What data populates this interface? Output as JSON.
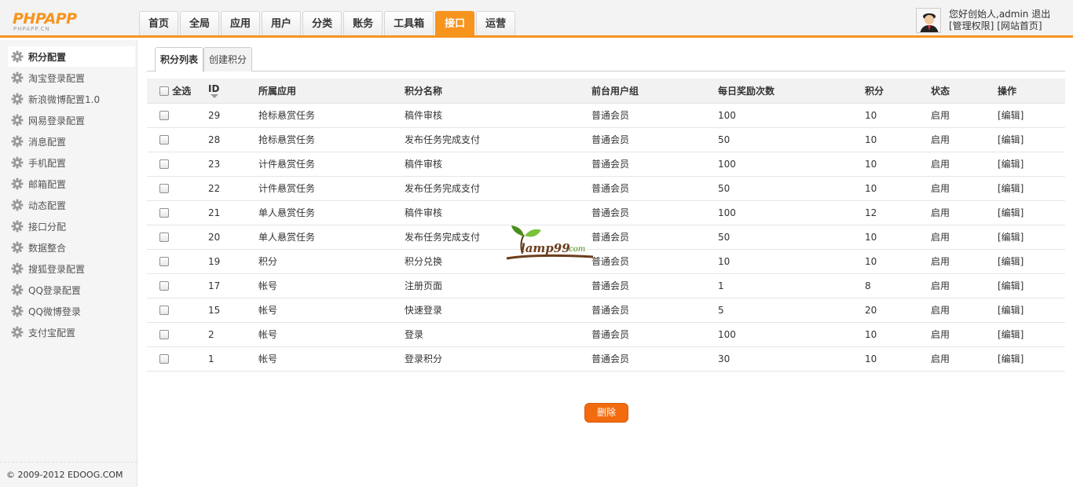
{
  "header": {
    "logo_text": "PHPAPP",
    "logo_sub": "PHPAPP.CN",
    "nav": [
      "首页",
      "全局",
      "应用",
      "用户",
      "分类",
      "账务",
      "工具箱",
      "接口",
      "运营"
    ],
    "nav_active_index": 7,
    "user": {
      "greeting": "您好创始人,admin",
      "logout": "退出",
      "admin_rights": "[管理权限]",
      "site_home": "[网站首页]"
    }
  },
  "sidebar": {
    "items": [
      "积分配置",
      "淘宝登录配置",
      "新浪微博配置1.0",
      "网易登录配置",
      "消息配置",
      "手机配置",
      "邮箱配置",
      "动态配置",
      "接口分配",
      "数据整合",
      "搜狐登录配置",
      "QQ登录配置",
      "QQ微博登录",
      "支付宝配置"
    ],
    "active_index": 0,
    "copyright": "© 2009-2012 EDOOG.COM"
  },
  "subtabs": [
    "积分列表",
    "创建积分"
  ],
  "table": {
    "headers": {
      "select_all": "全选",
      "id": "ID",
      "app": "所属应用",
      "name": "积分名称",
      "group": "前台用户组",
      "daily": "每日奖励次数",
      "points": "积分",
      "status": "状态",
      "action": "操作"
    },
    "rows": [
      {
        "id": "29",
        "app": "抢标悬赏任务",
        "name": "稿件审核",
        "group": "普通会员",
        "daily": "100",
        "points": "10",
        "status": "启用",
        "action": "[编辑]"
      },
      {
        "id": "28",
        "app": "抢标悬赏任务",
        "name": "发布任务完成支付",
        "group": "普通会员",
        "daily": "50",
        "points": "10",
        "status": "启用",
        "action": "[编辑]"
      },
      {
        "id": "23",
        "app": "计件悬赏任务",
        "name": "稿件审核",
        "group": "普通会员",
        "daily": "100",
        "points": "10",
        "status": "启用",
        "action": "[编辑]"
      },
      {
        "id": "22",
        "app": "计件悬赏任务",
        "name": "发布任务完成支付",
        "group": "普通会员",
        "daily": "50",
        "points": "10",
        "status": "启用",
        "action": "[编辑]"
      },
      {
        "id": "21",
        "app": "单人悬赏任务",
        "name": "稿件审核",
        "group": "普通会员",
        "daily": "100",
        "points": "12",
        "status": "启用",
        "action": "[编辑]"
      },
      {
        "id": "20",
        "app": "单人悬赏任务",
        "name": "发布任务完成支付",
        "group": "普通会员",
        "daily": "50",
        "points": "10",
        "status": "启用",
        "action": "[编辑]"
      },
      {
        "id": "19",
        "app": "积分",
        "name": "积分兑换",
        "group": "普通会员",
        "daily": "10",
        "points": "10",
        "status": "启用",
        "action": "[编辑]"
      },
      {
        "id": "17",
        "app": "帐号",
        "name": "注册页面",
        "group": "普通会员",
        "daily": "1",
        "points": "8",
        "status": "启用",
        "action": "[编辑]"
      },
      {
        "id": "15",
        "app": "帐号",
        "name": "快速登录",
        "group": "普通会员",
        "daily": "5",
        "points": "20",
        "status": "启用",
        "action": "[编辑]"
      },
      {
        "id": "2",
        "app": "帐号",
        "name": "登录",
        "group": "普通会员",
        "daily": "100",
        "points": "10",
        "status": "启用",
        "action": "[编辑]"
      },
      {
        "id": "1",
        "app": "帐号",
        "name": "登录积分",
        "group": "普通会员",
        "daily": "30",
        "points": "10",
        "status": "启用",
        "action": "[编辑]"
      }
    ]
  },
  "delete_button": "删除",
  "watermark": {
    "text": "lamp99",
    "suffix": ".com"
  },
  "colors": {
    "accent": "#f7941d",
    "delete_button": "#f26b0e"
  }
}
